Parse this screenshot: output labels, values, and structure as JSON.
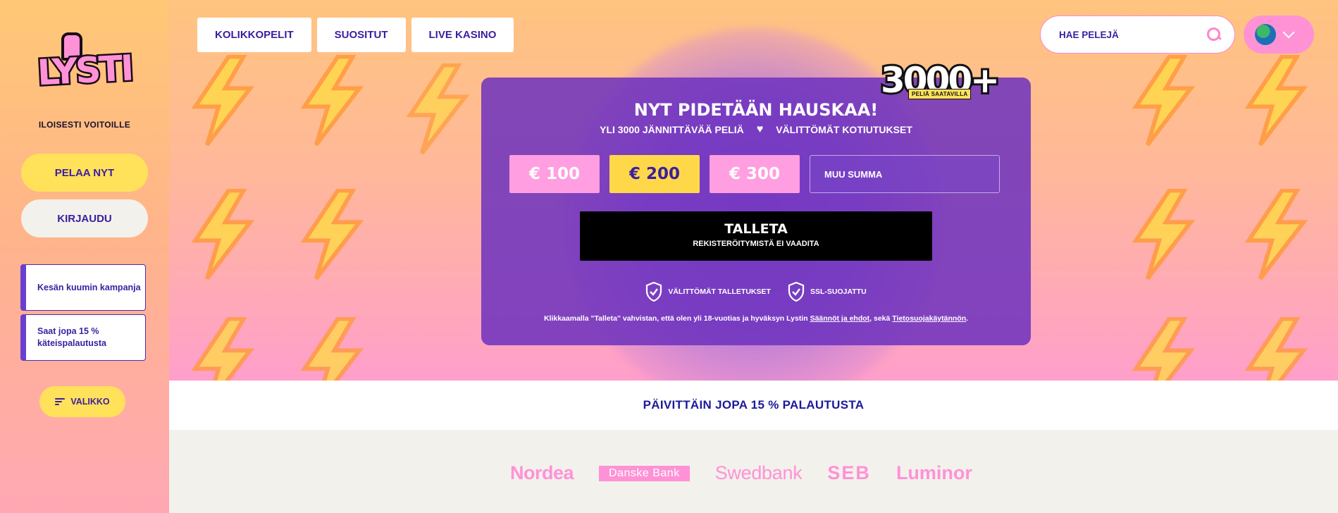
{
  "sidebar": {
    "logo_text": "LYSTI",
    "tagline": "ILOISESTI VOITOILLE",
    "play_label": "PELAA NYT",
    "login_label": "KIRJAUDU",
    "promos": [
      {
        "label": "Kesän kuumin kampanja"
      },
      {
        "label": "Saat jopa 15 % käteispalautusta"
      }
    ],
    "menu_label": "VALIKKO"
  },
  "header": {
    "nav": [
      {
        "label": "KOLIKKOPELIT"
      },
      {
        "label": "SUOSITUT"
      },
      {
        "label": "LIVE KASINO"
      }
    ],
    "search": {
      "placeholder": "HAE PELEJÄ"
    },
    "language_icon": "globe-icon"
  },
  "badge": {
    "number": "3000+",
    "caption": "PELIÄ SAATAVILLA"
  },
  "deposit": {
    "title": "NYT PIDETÄÄN HAUSKAA!",
    "subtitle_left": "YLI 3000 JÄNNITTÄVÄÄ PELIÄ",
    "subtitle_right": "VÄLITTÖMÄT KOTIUTUKSET",
    "amounts": [
      "€ 100",
      "€ 200",
      "€ 300"
    ],
    "selected_amount": "€ 200",
    "other_placeholder": "MUU SUMMA",
    "button_label": "TALLETA",
    "button_sub": "REKISTERÖITYMISTÄ EI VAADITA",
    "trust": [
      "VÄLITTÖMÄT TALLETUKSET",
      "SSL-SUOJATTU"
    ],
    "legal_prefix": "Klikkaamalla \"Talleta\" vahvistan, että olen yli 18-vuotias ja hyväksyn Lystin ",
    "legal_link1": "Säännöt ja ehdot",
    "legal_mid": ", sekä ",
    "legal_link2": "Tietosuojakäytännön",
    "legal_suffix": "."
  },
  "strip": {
    "text": "PÄIVITTÄIN JOPA 15 % PALAUTUSTA"
  },
  "banks": [
    "Nordea",
    "Danske Bank",
    "Swedbank",
    "SEB",
    "Luminor"
  ],
  "colors": {
    "purple": "#3a1fa0",
    "pink": "#ff92d6",
    "yellow": "#ffe15a",
    "card": "#6e32be"
  }
}
